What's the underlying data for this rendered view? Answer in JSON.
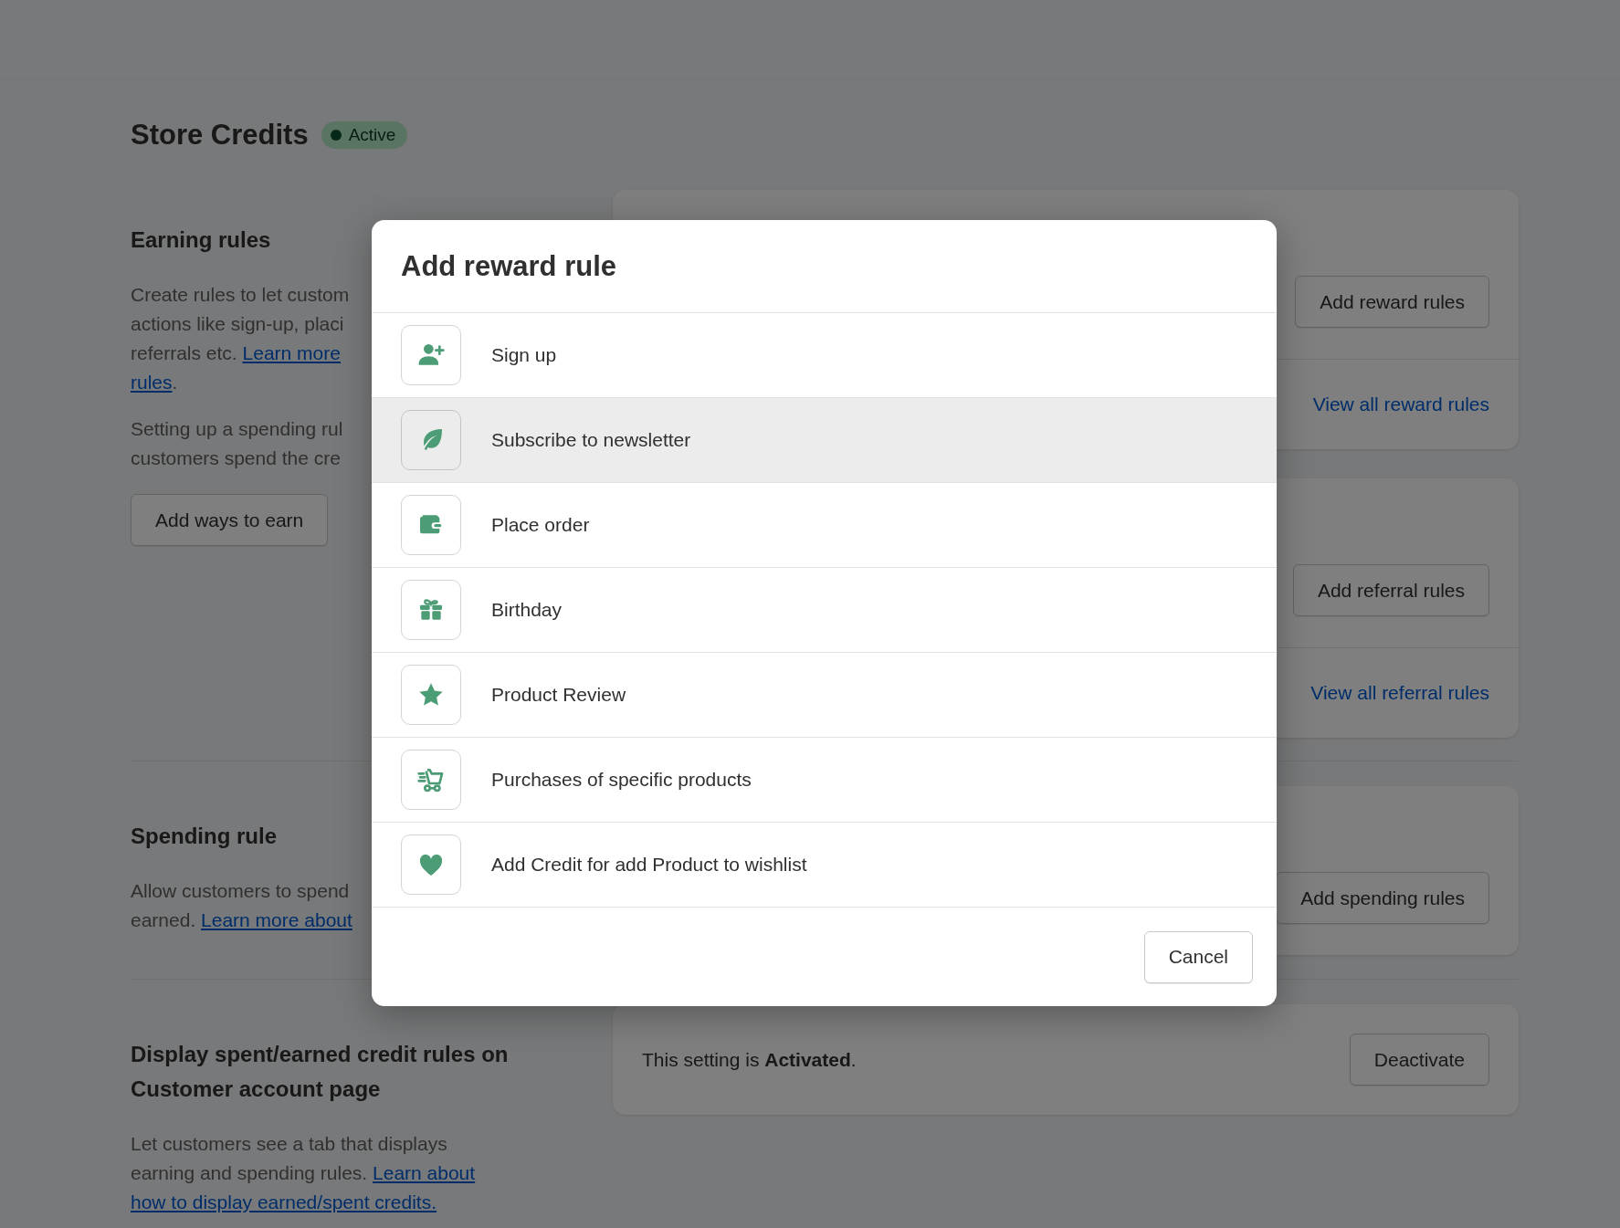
{
  "page": {
    "title": "Store Credits",
    "status_badge": {
      "label": "Active"
    }
  },
  "sections": [
    {
      "heading": "Earning rules",
      "paragraphs": [
        [
          {
            "text": "Create rules to let custom"
          },
          {
            "text": "actions like sign-up, placi"
          },
          {
            "text": "referrals etc. ",
            "link": "Learn more"
          },
          {
            "link": "rules",
            "after": "."
          }
        ],
        [
          {
            "text": "Setting up a spending rul"
          },
          {
            "text": "customers spend the cre"
          }
        ]
      ],
      "button": "Add ways to earn",
      "cards": [
        {
          "action": "Add reward rules",
          "link": "View all reward rules"
        },
        {
          "action": "Add referral rules",
          "link": "View all referral rules"
        }
      ]
    },
    {
      "heading": "Spending rule",
      "paragraphs": [
        [
          {
            "text": "Allow customers to spend"
          },
          {
            "text": "earned. ",
            "link": "Learn more about"
          }
        ]
      ],
      "cards": [
        {
          "action": "Add spending rules"
        }
      ]
    },
    {
      "heading": "Display spent/earned credit rules on Customer account page",
      "paragraphs": [
        [
          {
            "text": "Let customers see a tab that displays"
          },
          {
            "text": "earning and spending rules. ",
            "link": "Learn about"
          },
          {
            "link": "how to display earned/spent credits."
          }
        ]
      ],
      "cards": [
        {
          "setting": "This setting is **Activated**.",
          "action": "Deactivate"
        }
      ]
    }
  ],
  "modal": {
    "title": "Add reward rule",
    "options": [
      {
        "label": "Sign up",
        "selected": false
      },
      {
        "label": "Subscribe to newsletter",
        "selected": true
      },
      {
        "label": "Place order",
        "selected": false
      },
      {
        "label": "Birthday",
        "selected": false
      },
      {
        "label": "Product Review",
        "selected": false
      },
      {
        "label": "Purchases of specific products",
        "selected": false
      },
      {
        "label": "Add Credit for add Product to wishlist",
        "selected": false
      }
    ],
    "cancel": "Cancel"
  }
}
